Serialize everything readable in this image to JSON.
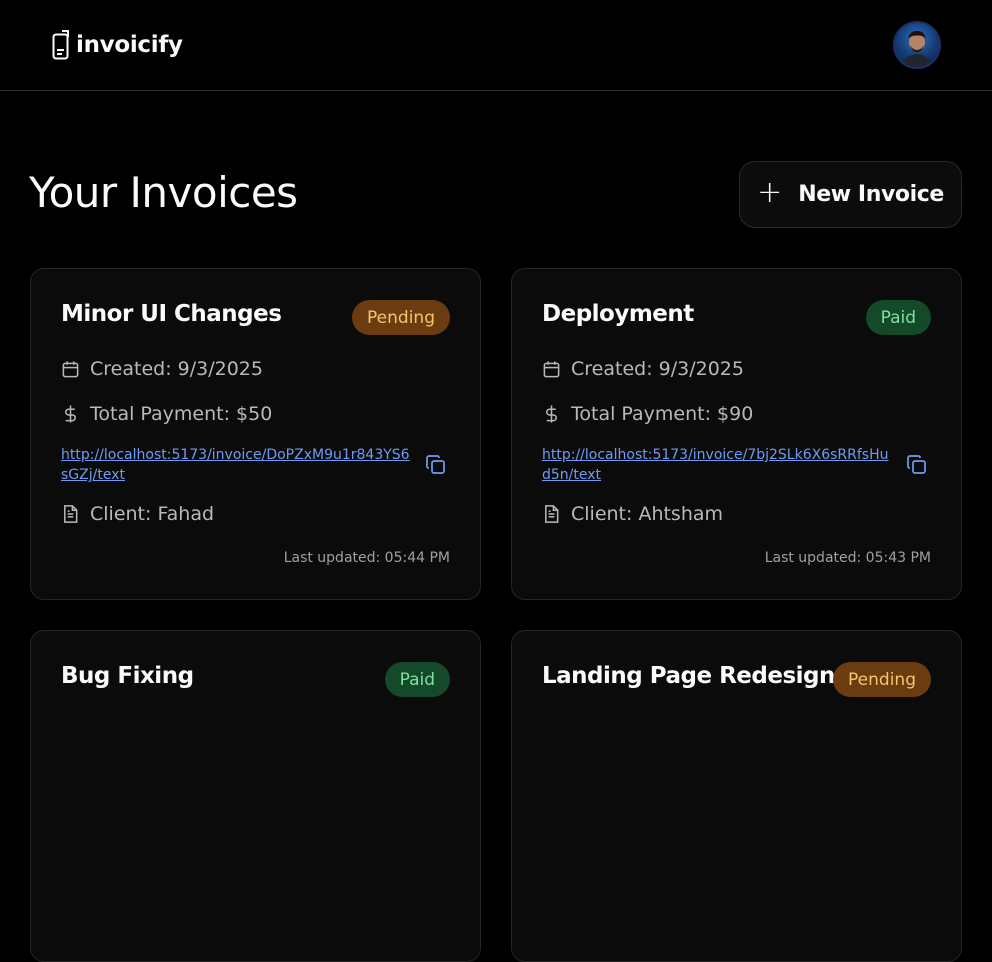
{
  "header": {
    "logo_text": "invoicify",
    "avatar_alt": "User avatar"
  },
  "main": {
    "title": "Your Invoices",
    "new_invoice_label": "New Invoice",
    "new_invoice_icon": "plus-icon"
  },
  "invoices": [
    {
      "title": "Minor UI Changes",
      "status": "Pending",
      "created": "Created: 9/3/2025",
      "total": "Total Payment: $50",
      "link": "http://localhost:5173/invoice/DoPZxM9u1r843YS6sGZj/text",
      "client": "Client: Fahad",
      "updated": "Last updated: 05:44 PM"
    },
    {
      "title": "Deployment",
      "status": "Paid",
      "created": "Created: 9/3/2025",
      "total": "Total Payment: $90",
      "link": "http://localhost:5173/invoice/7bj2SLk6X6sRRfsHud5n/text",
      "client": "Client: Ahtsham",
      "updated": "Last updated: 05:43 PM"
    },
    {
      "title": "Bug Fixing",
      "status": "Paid"
    },
    {
      "title": "Landing Page Redesign",
      "status": "Pending"
    }
  ],
  "colors": {
    "background": "#000000",
    "card": "#0b0b0c",
    "pending_bg": "#6b3c0f",
    "pending_text": "#f6c66a",
    "paid_bg": "#14492a",
    "paid_text": "#7fe0a1",
    "link": "#6f9cf2"
  },
  "icons": {
    "calendar": "calendar-icon",
    "dollar": "dollar-icon",
    "copy": "copy-icon",
    "document": "document-icon"
  }
}
